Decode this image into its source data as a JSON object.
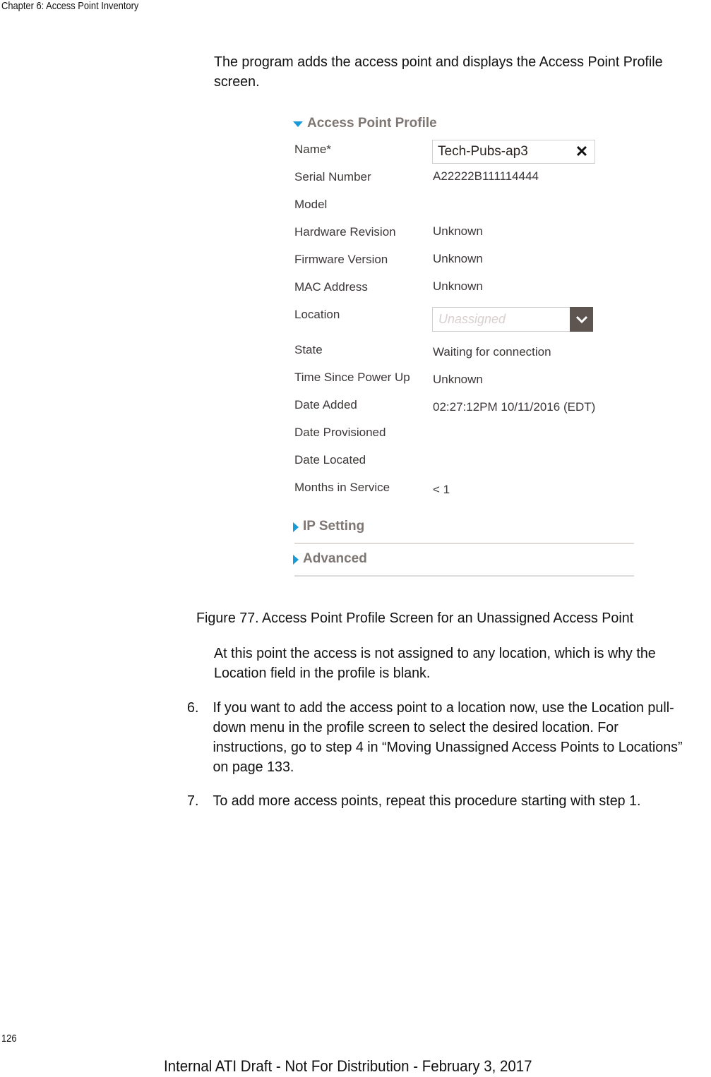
{
  "running_header": "Chapter 6: Access Point Inventory",
  "intro_text": "The program adds the access point and displays the Access Point Profile screen.",
  "figure": {
    "profile_section": {
      "title": "Access Point Profile",
      "expanded": true,
      "fields": {
        "name": {
          "label": "Name*",
          "value": "Tech-Pubs-ap3"
        },
        "serial_number": {
          "label": "Serial Number",
          "value": "A22222B111114444"
        },
        "model": {
          "label": "Model",
          "value": ""
        },
        "hardware_revision": {
          "label": "Hardware Revision",
          "value": "Unknown"
        },
        "firmware_version": {
          "label": "Firmware Version",
          "value": "Unknown"
        },
        "mac_address": {
          "label": "MAC Address",
          "value": "Unknown"
        },
        "location": {
          "label": "Location",
          "placeholder": "Unassigned",
          "value": ""
        },
        "state": {
          "label": "State",
          "value": "Waiting for connection"
        },
        "time_since_power_up": {
          "label": "Time Since Power Up",
          "value": "Unknown"
        },
        "date_added": {
          "label": "Date Added",
          "value": "02:27:12PM 10/11/2016 (EDT)"
        },
        "date_provisioned": {
          "label": "Date Provisioned",
          "value": ""
        },
        "date_located": {
          "label": "Date Located",
          "value": ""
        },
        "months_in_service": {
          "label": "Months in Service",
          "value": "< 1"
        }
      }
    },
    "ip_setting_section": {
      "title": "IP Setting",
      "expanded": false
    },
    "advanced_section": {
      "title": "Advanced",
      "expanded": false
    },
    "icons": {
      "expand": "triangle-down-icon",
      "collapse": "triangle-right-icon",
      "clear": "close-x-icon",
      "dropdown": "chevron-down-icon"
    },
    "colors": {
      "accent_triangle": "#1a9bd6",
      "section_title": "#7d7672",
      "dropdown_button": "#5e5450"
    }
  },
  "caption": "Figure 77. Access Point Profile Screen for an Unassigned Access Point",
  "para_after_figure": "At this point the access is not assigned to any location, which is why the Location field in the profile is blank.",
  "steps": [
    {
      "number": "6.",
      "text": "If you want to add the access point to a location now, use the Location pull-down menu in the profile screen to select the desired location. For instructions, go to step 4 in “Moving Unassigned Access Points to Locations” on page 133."
    },
    {
      "number": "7.",
      "text": "To add more access points, repeat this procedure starting with step 1."
    }
  ],
  "page_number": "126",
  "footer": "Internal ATI Draft - Not For Distribution - February 3, 2017"
}
